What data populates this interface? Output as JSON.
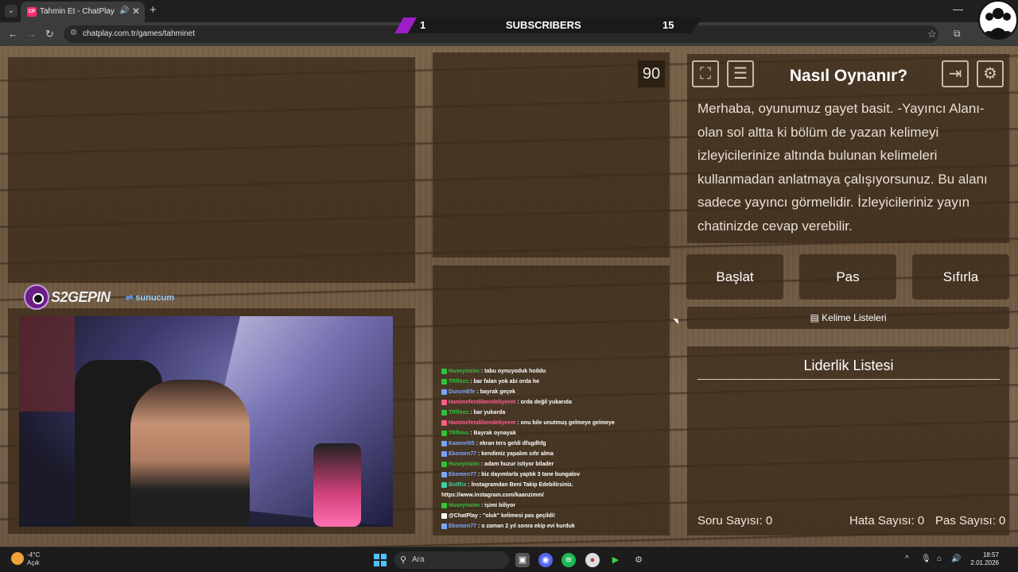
{
  "browser": {
    "tab_title": "Tahmin Et - ChatPlay",
    "tab_favicon": "CP",
    "url": "chatplay.com.tr/games/tahminet",
    "icons": [
      "chevron-down-icon",
      "audio-icon",
      "close-icon",
      "plus-icon",
      "back-icon",
      "forward-icon",
      "reload-icon",
      "site-info-icon",
      "star-icon",
      "extension-icon",
      "minimize-icon"
    ]
  },
  "subscriber_bar": {
    "left_value": "1",
    "label": "SUBSCRIBERS",
    "right_value": "15",
    "accent": "#9b1fc4"
  },
  "stream": {
    "logo_text": "S2GEPIN",
    "sponsor_text_a": "sunucum",
    "timer": "90"
  },
  "chat": [
    {
      "user": "Huseyinzim",
      "msg": "tabu oynuyoduk hoildu",
      "color": "#31c23a"
    },
    {
      "user": "TRflexs",
      "msg": "bar falan yok abi orda he",
      "color": "#31c23a"
    },
    {
      "user": "DurumEfe",
      "msg": "bayrak geçek",
      "color": "#7aa5ff"
    },
    {
      "user": "Hanimefendibendeliyeem",
      "msg": "orda değil yukarıda",
      "color": "#ff5f8a"
    },
    {
      "user": "TRflexs",
      "msg": "bar yukarda",
      "color": "#31c23a"
    },
    {
      "user": "Hanimefendibendeliyeem",
      "msg": "onu bile unutmuş gelmeye gelmeye",
      "color": "#ff5f8a"
    },
    {
      "user": "TRflexs",
      "msg": "Bayrak oynayak",
      "color": "#31c23a"
    },
    {
      "user": "Kaamel05",
      "msg": "ekran ters geldi dfsgdhfg",
      "color": "#7aa5ff"
    },
    {
      "user": "Ekomen77",
      "msg": "kendimiz yapalım sıfır alma",
      "color": "#7aa5ff"
    },
    {
      "user": "Huseyinzim",
      "msg": "adam huzur istiyor bilader",
      "color": "#31c23a"
    },
    {
      "user": "Ekomen77",
      "msg": "biz dayımlarla yaptık 3 tane bungalov",
      "color": "#7aa5ff"
    },
    {
      "user": "BotRix",
      "msg": "İnstagramdan Beni Takip Edebilirsiniz.",
      "color": "#3cd0a0"
    },
    {
      "user": "",
      "msg": "https://www.instagram.com/kaanzimm/",
      "color": "#ffffff"
    },
    {
      "user": "Huseyinzim",
      "msg": "işimi biliyor",
      "color": "#31c23a"
    },
    {
      "user": "@ChatPlay",
      "msg": "\"oluk\" kelimesi pas geçildi!",
      "color": "#ffffff"
    },
    {
      "user": "Ekomen77",
      "msg": "o zaman 2 yıl sonra ekip evi kurduk",
      "color": "#7aa5ff"
    }
  ],
  "game": {
    "title": "Nasıl Oynanır?",
    "instructions": "Merhaba, oyunumuz gayet basit. -Yayıncı Alanı- olan sol altta ki bölüm de yazan kelimeyi izleyicilerinize altında bulunan kelimeleri kullanmadan anlatmaya çalışıyorsunuz. Bu alanı sadece yayıncı görmelidir. İzleyicileriniz yayın chatinizde cevap verebilir.",
    "buttons": {
      "start": "Başlat",
      "pass": "Pas",
      "reset": "Sıfırla"
    },
    "word_lists": "Kelime Listeleri",
    "leaderboard_title": "Liderlik Listesi",
    "stats": {
      "questions_label": "Soru Sayısı:",
      "questions": "0",
      "errors_label": "Hata Sayısı:",
      "errors": "0",
      "passes_label": "Pas Sayısı:",
      "passes": "0"
    }
  },
  "taskbar": {
    "temp": "-4°C",
    "weather": "Açık",
    "search_placeholder": "Ara",
    "time": "18:57",
    "date": "2.01.2026"
  }
}
